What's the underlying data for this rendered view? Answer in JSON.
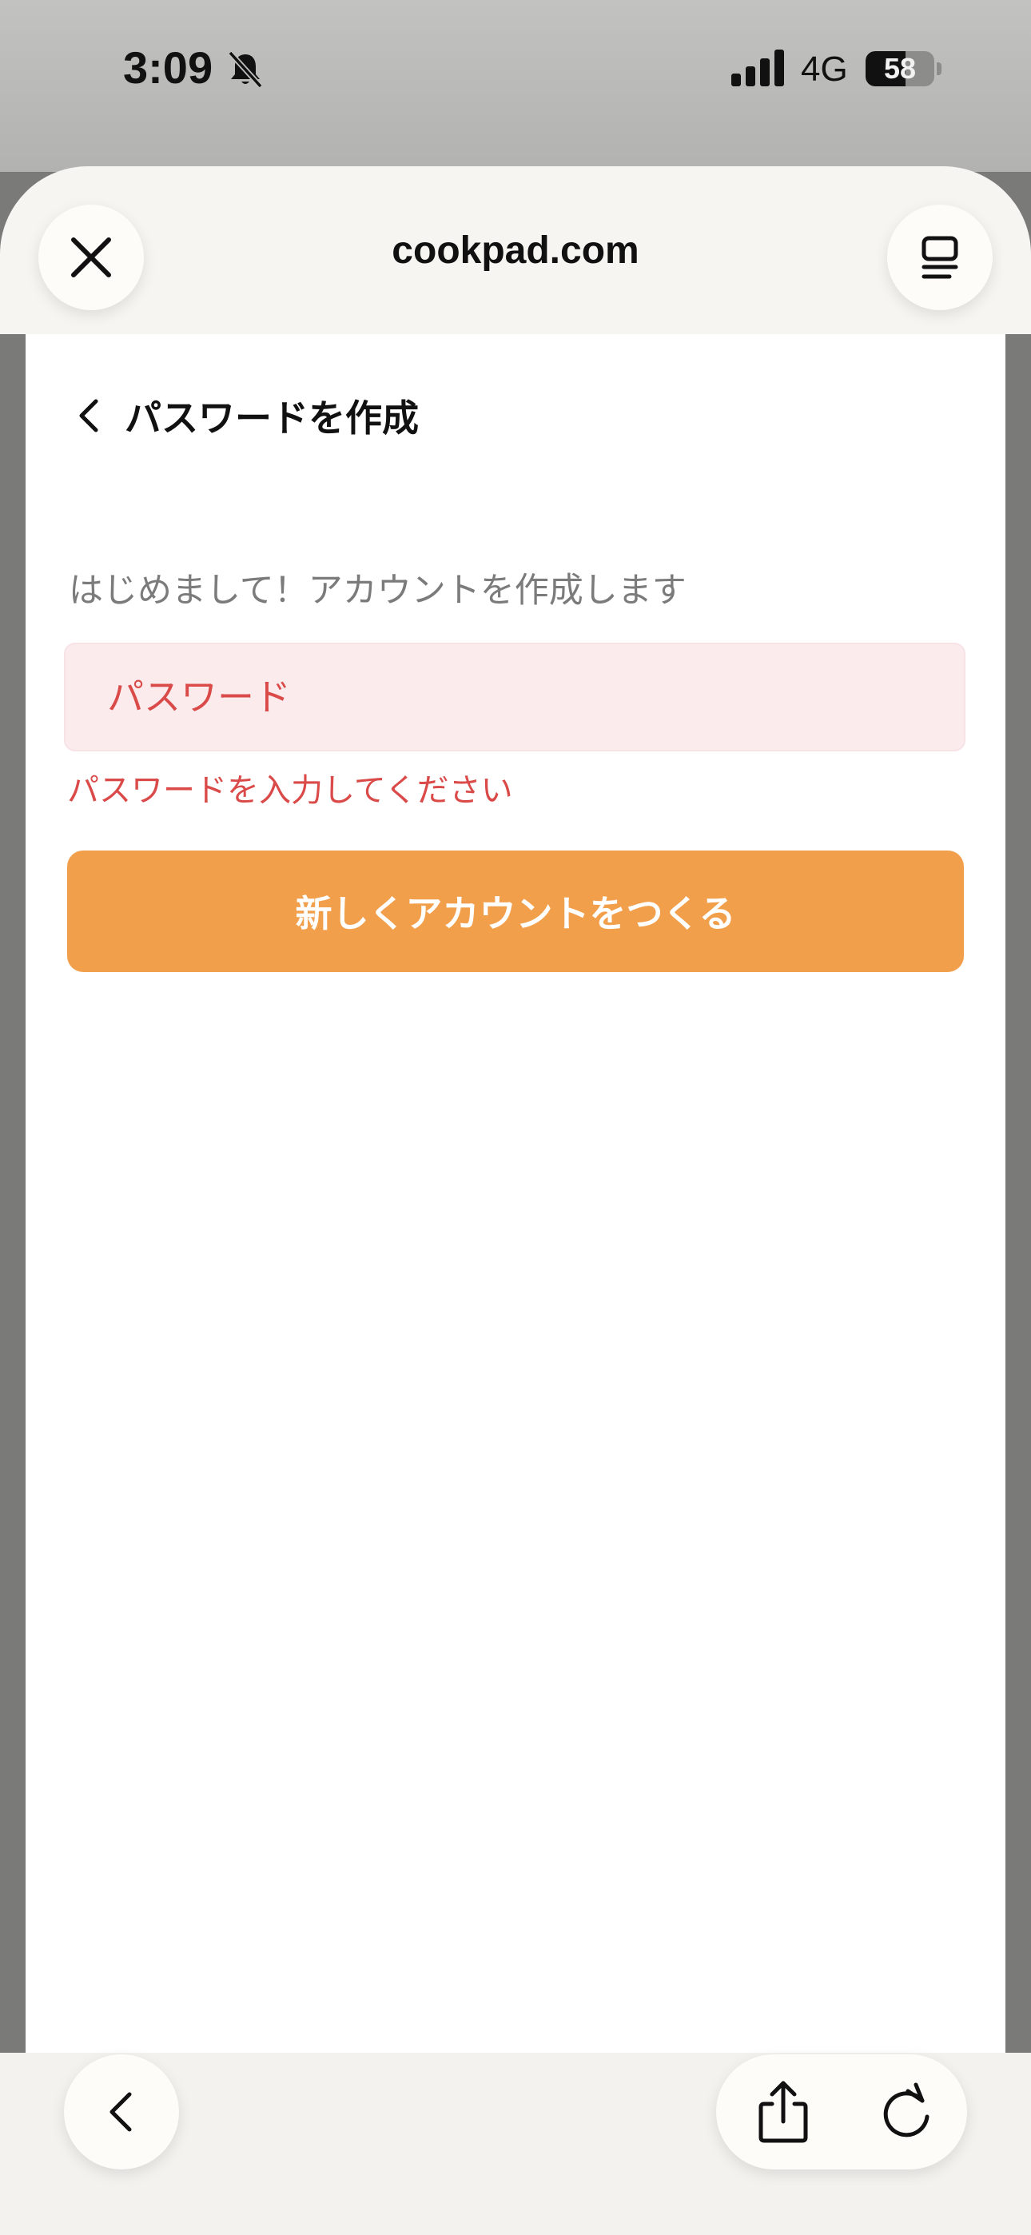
{
  "status_bar": {
    "time": "3:09",
    "network": "4G",
    "battery_percent": "58"
  },
  "browser": {
    "site_title": "cookpad.com"
  },
  "page": {
    "title": "パスワードを作成",
    "intro": "はじめまして！アカウントを作成します",
    "password_placeholder": "パスワード",
    "error_message": "パスワードを入力してください",
    "create_button_label": "新しくアカウントをつくる"
  },
  "colors": {
    "accent": "#f29f4b",
    "error": "#d94a48",
    "error_field_bg": "#fbebed"
  },
  "icons": {
    "close": "close-icon",
    "tabs": "tabs-icon",
    "back": "chevron-left-icon",
    "share": "share-icon",
    "reload": "reload-icon",
    "bell_muted": "bell-slash-icon"
  }
}
